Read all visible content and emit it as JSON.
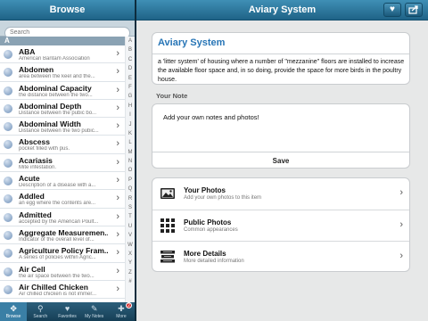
{
  "left": {
    "header_title": "Browse",
    "search_placeholder": "Search",
    "section_letter": "A",
    "items": [
      {
        "title": "ABA",
        "subtitle": "American Bantam Association"
      },
      {
        "title": "Abdomen",
        "subtitle": "area between the keel and the..."
      },
      {
        "title": "Abdominal Capacity",
        "subtitle": "the distance between the two..."
      },
      {
        "title": "Abdominal Depth",
        "subtitle": "Distance between the pubic bo..."
      },
      {
        "title": "Abdominal Width",
        "subtitle": "Distance between the two pubic..."
      },
      {
        "title": "Abscess",
        "subtitle": "pocket filled with pus."
      },
      {
        "title": "Acariasis",
        "subtitle": "Mite infestation."
      },
      {
        "title": "Acute",
        "subtitle": "Description of a disease with a..."
      },
      {
        "title": "Addled",
        "subtitle": "an egg where the contents are..."
      },
      {
        "title": "Admitted",
        "subtitle": "accepted by the American Poult..."
      },
      {
        "title": "Aggregate Measuremen...",
        "subtitle": "Indicator of the overall level of..."
      },
      {
        "title": "Agriculture Policy Fram...",
        "subtitle": "A series of policies within Agric..."
      },
      {
        "title": "Air Cell",
        "subtitle": "the air space between the two..."
      },
      {
        "title": "Air Chilled Chicken",
        "subtitle": "Air chilled chicken is not immer..."
      }
    ],
    "alpha_index": [
      "A",
      "B",
      "C",
      "D",
      "E",
      "F",
      "G",
      "H",
      "I",
      "J",
      "K",
      "L",
      "M",
      "N",
      "O",
      "P",
      "Q",
      "R",
      "S",
      "T",
      "U",
      "V",
      "W",
      "X",
      "Y",
      "Z",
      "#"
    ],
    "tabs": [
      {
        "label": "Browse",
        "icon": "compass-icon",
        "glyph": "✥"
      },
      {
        "label": "Search",
        "icon": "search-icon",
        "glyph": "⚲"
      },
      {
        "label": "Favorites",
        "icon": "heart-icon",
        "glyph": "♥"
      },
      {
        "label": "My Notes",
        "icon": "speech-bubble-icon",
        "glyph": "✎"
      },
      {
        "label": "More",
        "icon": "plus-icon",
        "glyph": "✚",
        "badge": "2"
      }
    ]
  },
  "right": {
    "header_title": "Aviary System",
    "term_title": "Aviary System",
    "definition": "a 'litter system' of housing where a number of \"mezzanine\" floors are installed to increase the available floor space and, in so doing, provide the space for more birds in the poultry house.",
    "note_heading": "Your Note",
    "note_placeholder": "Add your own notes and photos!",
    "save_label": "Save",
    "links": [
      {
        "title": "Your Photos",
        "subtitle": "Add your own photos to this item"
      },
      {
        "title": "Public Photos",
        "subtitle": "Common appearances"
      },
      {
        "title": "More Details",
        "subtitle": "More detailed information"
      }
    ]
  },
  "colors": {
    "header": "#2a7aa3",
    "accent_title": "#2775b6",
    "tabbar": "#1e4d68"
  }
}
